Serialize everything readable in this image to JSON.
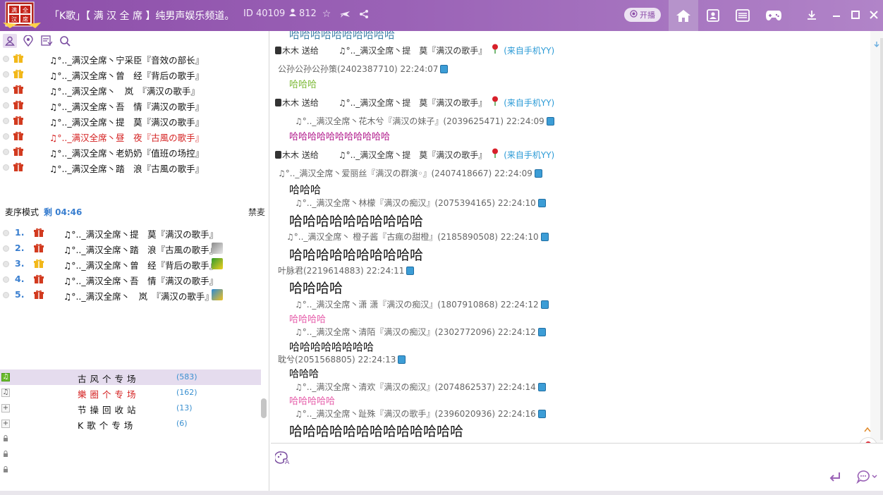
{
  "header": {
    "logo_text": "满全汉席",
    "title": "「K歌」【 满 汉 全 席 】纯男声娱乐频道。",
    "channel_id": "ID 40109",
    "user_count": "812",
    "live_label": "开播"
  },
  "left_tabs": [
    "user-icon",
    "location-icon",
    "list-icon",
    "search-icon"
  ],
  "mic_users": [
    {
      "name": "♫°.._满汉全席丶宁采臣『音效の部长』",
      "gift": "gold",
      "color": "#111111"
    },
    {
      "name": "♫°.._满汉全席丶曾　经『背后の歌手』",
      "gift": "gold",
      "color": "#111111"
    },
    {
      "name": "♫°.._满汉全席丶　岚　『满汉の歌手』",
      "gift": "red",
      "color": "#111111"
    },
    {
      "name": "♫°.._满汉全席丶吾　情『满汉の歌手』",
      "gift": "red",
      "color": "#111111"
    },
    {
      "name": "♫°.._满汉全席丶提　莫『满汉の歌手』",
      "gift": "red",
      "color": "#111111"
    },
    {
      "name": "♫°.._满汉全席丶昼　夜『古風の歌手』",
      "gift": "red",
      "color": "#d42020"
    },
    {
      "name": "♫°.._满汉全席丶老奶奶『值班の场控』",
      "gift": "red",
      "color": "#111111"
    },
    {
      "name": "♫°.._满汉全席丶踏　浪『古風の歌手』",
      "gift": "red",
      "color": "#111111"
    }
  ],
  "queue": {
    "mode_label": "麦序模式",
    "time_label": "剩 04:46",
    "ban_label": "禁麦",
    "items": [
      {
        "num": "1.",
        "gift": "red",
        "name": "♫°.._满汉全席丶提　莫『满汉の歌手』",
        "badge": ""
      },
      {
        "num": "2.",
        "gift": "red",
        "name": "♫°.._满汉全席丶踏　浪『古風の歌手』",
        "badge": "photo"
      },
      {
        "num": "3.",
        "gift": "gold",
        "name": "♫°.._满汉全席丶曾　经『背后の歌手』",
        "badge": "green"
      },
      {
        "num": "4.",
        "gift": "red",
        "name": "♫°.._满汉全席丶吾　情『满汉の歌手』",
        "badge": ""
      },
      {
        "num": "5.",
        "gift": "red",
        "name": "♫°.._满汉全席丶　岚　『满汉の歌手』",
        "badge": "blue"
      }
    ]
  },
  "channels": [
    {
      "name": "古风个专场",
      "count": "(583)",
      "color": "#111111",
      "icon": "music",
      "selected": true
    },
    {
      "name": "樂圈个专场",
      "count": "(162)",
      "color": "#d42020",
      "icon": "music",
      "selected": false
    },
    {
      "name": "节操回收站",
      "count": "(13)",
      "color": "#111111",
      "icon": "plus",
      "selected": false
    },
    {
      "name": "K歌个专场",
      "count": "(6)",
      "color": "#111111",
      "icon": "plus",
      "selected": false
    },
    {
      "name": "",
      "count": "",
      "color": "#111111",
      "icon": "lock",
      "selected": false
    },
    {
      "name": "",
      "count": "",
      "color": "#111111",
      "icon": "lock",
      "selected": false
    },
    {
      "name": "",
      "count": "",
      "color": "#111111",
      "icon": "lock",
      "selected": false
    }
  ],
  "chat": {
    "top_cut": "哈哈哈哈哈哈哈哈哈哈",
    "gift_sender": "木木 送给",
    "gift_receiver": "♫°.._满汉全席丶提　莫『满汉の歌手』",
    "gift_source": "(来自手机YY)",
    "messages": [
      {
        "user": "公孙公孙公孙策(2402387710) 22:24:07",
        "text": "哈哈哈",
        "color": "#7ab832",
        "size": 13
      },
      {
        "user": "♫°.._满汉全席丶花木兮『满汉の妹子』(2039625471) 22:24:09",
        "text": "哈哈哈哈哈哈哈哈哈哈哈",
        "color": "#b0168a",
        "size": 13
      },
      {
        "user": "♫°.._满汉全席丶爱丽丝『满汉の群演◦』(2407418667) 22:24:09",
        "text": "哈哈哈",
        "color": "#111111",
        "size": 15
      },
      {
        "user": "♫°.._满汉全席丶林檬『满汉の痴汉』(2075394165) 22:24:10",
        "text": "哈哈哈哈哈哈哈哈哈哈",
        "color": "#111111",
        "size": 19
      },
      {
        "user": "♫°.._满汉全席丶 橙子酱『古瘋の甜橙』(2185890508) 22:24:10",
        "text": "哈哈哈哈哈哈哈哈哈哈",
        "color": "#111111",
        "size": 19
      },
      {
        "user": "叶脉君(2219614883) 22:24:11",
        "text": "哈哈哈哈",
        "color": "#111111",
        "size": 19
      },
      {
        "user": "♫°.._满汉全席丶潇 潇『满汉の痴汉』(1807910868) 22:24:12",
        "text": "哈哈哈哈",
        "color": "#e55aa8",
        "size": 13
      },
      {
        "user": "♫°.._满汉全席丶清陌『满汉の痴汉』(2302772096) 22:24:12",
        "text": "哈哈哈哈哈哈哈哈",
        "color": "#111111",
        "size": 15
      },
      {
        "user": "耽兮(2051568805) 22:24:13",
        "text": "哈哈哈",
        "color": "#111111",
        "size": 14
      },
      {
        "user": "♫°.._满汉全席丶清欢『满汉の痴汉』(2074862537) 22:24:14",
        "text": "哈哈哈哈哈",
        "color": "#e55aa8",
        "size": 13
      },
      {
        "user": "♫°.._满汉全席丶趾殊『满汉の歌手』(2396020936) 22:24:16",
        "text": "哈哈哈哈哈哈哈哈哈哈哈哈哈",
        "color": "#111111",
        "size": 19
      }
    ]
  },
  "colors": {
    "accent": "#8d4ea9",
    "blue": "#2a9ad6",
    "red": "#d42020"
  }
}
